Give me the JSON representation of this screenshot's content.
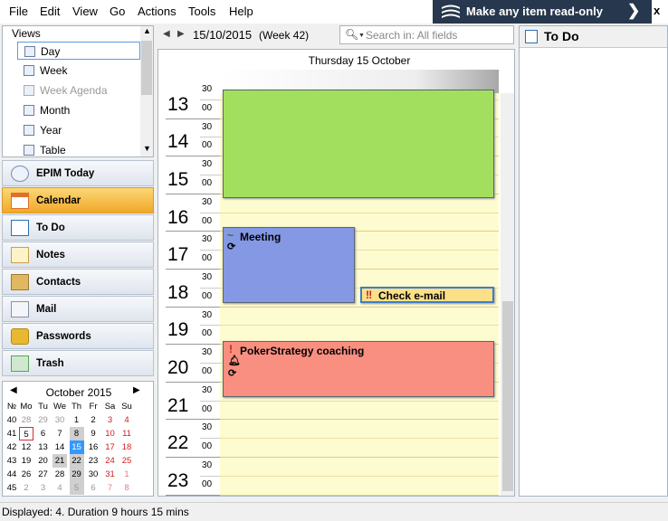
{
  "menu": [
    "File",
    "Edit",
    "View",
    "Go",
    "Actions",
    "Tools",
    "Help"
  ],
  "banner": {
    "text": "Make any item read-only",
    "close": "x"
  },
  "views": {
    "title": "Views",
    "items": [
      {
        "label": "Day",
        "icon": "day-view-icon",
        "selected": true
      },
      {
        "label": "Week",
        "icon": "week-view-icon",
        "selected": false
      },
      {
        "label": "Week Agenda",
        "icon": "week-agenda-icon",
        "selected": false
      },
      {
        "label": "Month",
        "icon": "month-view-icon",
        "selected": false
      },
      {
        "label": "Year",
        "icon": "year-view-icon",
        "selected": false
      },
      {
        "label": "Table",
        "icon": "table-view-icon",
        "selected": false
      }
    ]
  },
  "nav": [
    {
      "label": "EPIM Today",
      "icon": "today-icon",
      "active": false,
      "color": "#7a8fb0"
    },
    {
      "label": "Calendar",
      "icon": "calendar-icon",
      "active": true,
      "color": "#e0702a"
    },
    {
      "label": "To Do",
      "icon": "todo-icon",
      "active": false,
      "color": "#2d6fb5"
    },
    {
      "label": "Notes",
      "icon": "notes-icon",
      "active": false,
      "color": "#f4d680"
    },
    {
      "label": "Contacts",
      "icon": "contacts-icon",
      "active": false,
      "color": "#c9a04a"
    },
    {
      "label": "Mail",
      "icon": "mail-icon",
      "active": false,
      "color": "#d9dce3"
    },
    {
      "label": "Passwords",
      "icon": "lock-icon",
      "active": false,
      "color": "#e8b930"
    },
    {
      "label": "Trash",
      "icon": "trash-icon",
      "active": false,
      "color": "#5aa35a"
    }
  ],
  "minical": {
    "month": "October",
    "year": "2015",
    "headers": [
      "№",
      "Mo",
      "Tu",
      "We",
      "Th",
      "Fr",
      "Sa",
      "Su"
    ],
    "weeks": [
      {
        "no": "40",
        "days": [
          "28",
          "29",
          "30",
          "1",
          "2",
          "3",
          "4"
        ]
      },
      {
        "no": "41",
        "days": [
          "5",
          "6",
          "7",
          "8",
          "9",
          "10",
          "11"
        ]
      },
      {
        "no": "42",
        "days": [
          "12",
          "13",
          "14",
          "15",
          "16",
          "17",
          "18"
        ]
      },
      {
        "no": "43",
        "days": [
          "19",
          "20",
          "21",
          "22",
          "23",
          "24",
          "25"
        ]
      },
      {
        "no": "44",
        "days": [
          "26",
          "27",
          "28",
          "29",
          "30",
          "31",
          "1"
        ]
      },
      {
        "no": "45",
        "days": [
          "2",
          "3",
          "4",
          "5",
          "6",
          "7",
          "8"
        ]
      }
    ]
  },
  "toolbar": {
    "date": "15/10/2015",
    "week": "(Week 42)"
  },
  "search": {
    "placeholder": "Search in: All fields"
  },
  "day": {
    "header": "Thursday 15 October"
  },
  "hours": [
    "13",
    "14",
    "15",
    "16",
    "17",
    "18",
    "19",
    "20",
    "21",
    "22",
    "23"
  ],
  "minute_labels": [
    "30",
    "00"
  ],
  "events": [
    {
      "title": "",
      "color": "#a3df5f"
    },
    {
      "title": "Meeting",
      "color": "#8498e4",
      "icons": [
        "recurring-icon",
        "sync-icon"
      ]
    },
    {
      "title": "Check e-mail",
      "color": "#fce088",
      "icons": [
        "high-priority-icon"
      ]
    },
    {
      "title": "PokerStrategy coaching",
      "color": "#f98f80",
      "icons": [
        "priority-icon",
        "reminder-bell-icon",
        "sync-icon"
      ]
    }
  ],
  "todo": {
    "title": "To Do"
  },
  "status": "Displayed: 4. Duration 9 hours 15 mins",
  "colors": {
    "selected_day": "#3399ff",
    "today_border": "#d03030",
    "weekend": "#d02020",
    "active_nav": "#f1a829"
  }
}
